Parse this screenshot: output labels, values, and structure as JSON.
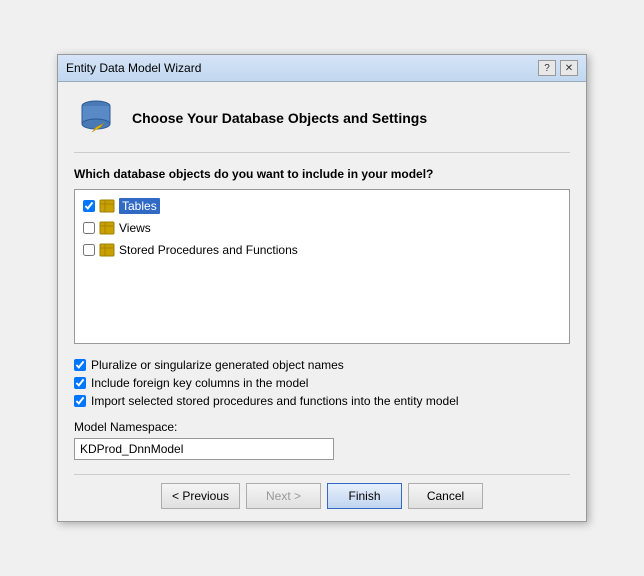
{
  "titleBar": {
    "title": "Entity Data Model Wizard",
    "helpBtn": "?",
    "closeBtn": "✕"
  },
  "header": {
    "title": "Choose Your Database Objects and Settings"
  },
  "objectsSection": {
    "label": "Which database objects do you want to include in your model?",
    "items": [
      {
        "id": "tables",
        "label": "Tables",
        "checked": true,
        "highlighted": true
      },
      {
        "id": "views",
        "label": "Views",
        "checked": false,
        "highlighted": false
      },
      {
        "id": "storedProcs",
        "label": "Stored Procedures and Functions",
        "checked": false,
        "highlighted": false
      }
    ]
  },
  "options": [
    {
      "id": "pluralize",
      "label": "Pluralize or singularize generated object names",
      "checked": true
    },
    {
      "id": "foreignKeys",
      "label": "Include foreign key columns in the model",
      "checked": true
    },
    {
      "id": "importStored",
      "label": "Import selected stored procedures and functions into the entity model",
      "checked": true
    }
  ],
  "namespace": {
    "label": "Model Namespace:",
    "value": "KDProd_DnnModel",
    "placeholder": ""
  },
  "buttons": {
    "previous": "< Previous",
    "next": "Next >",
    "finish": "Finish",
    "cancel": "Cancel"
  }
}
